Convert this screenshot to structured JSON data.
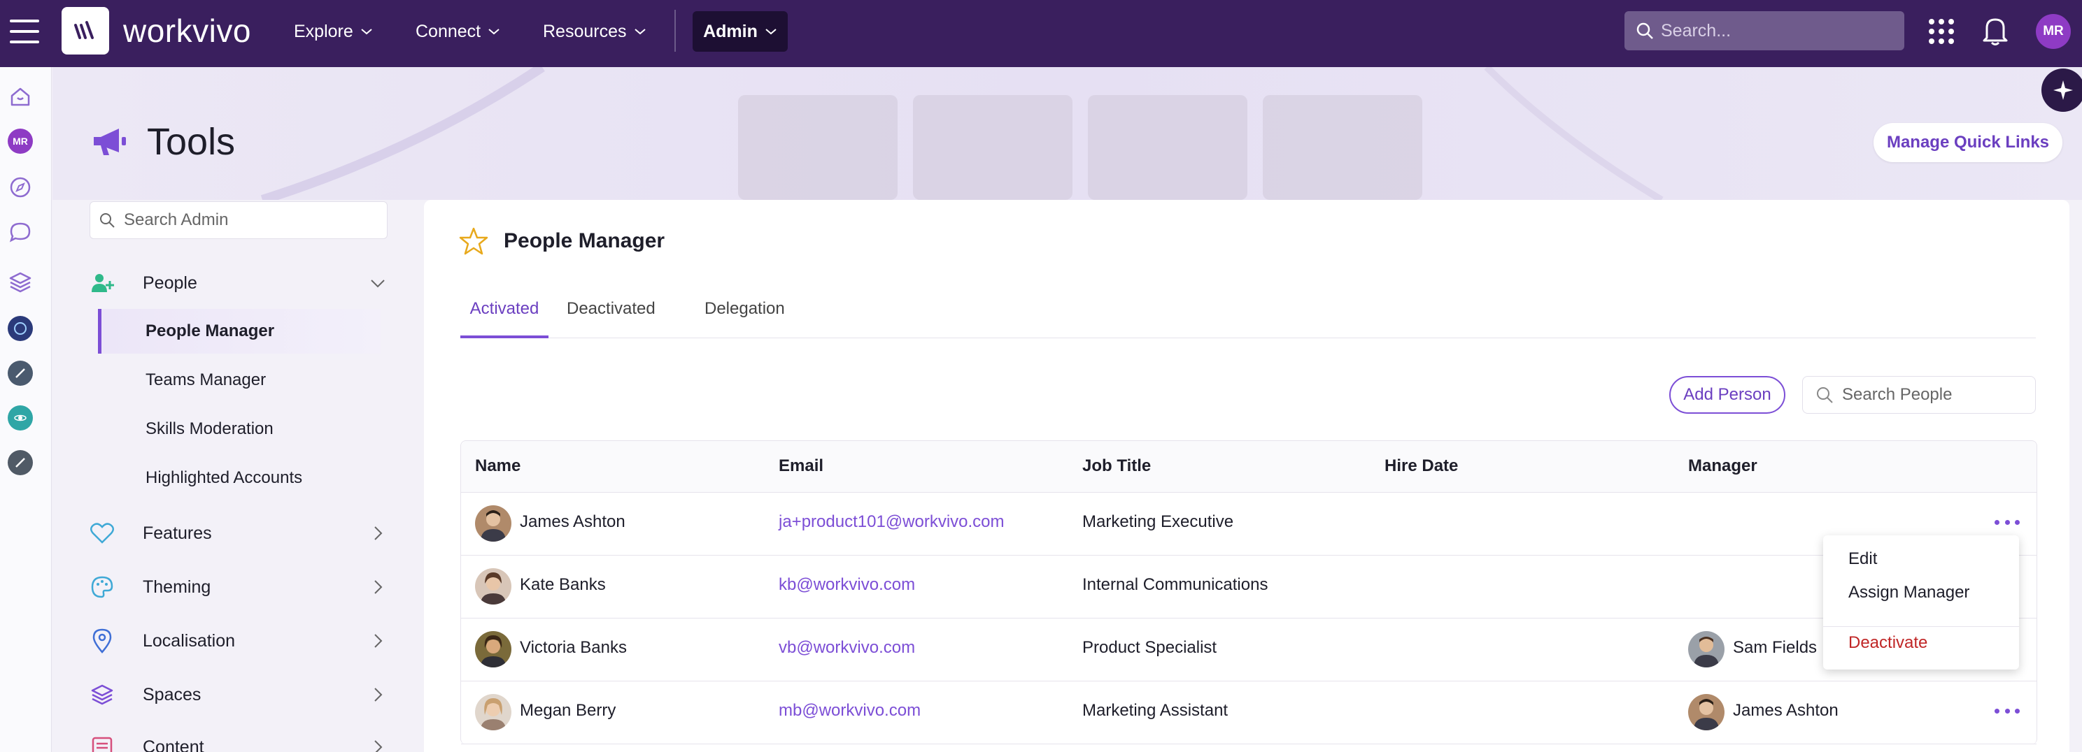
{
  "topbar": {
    "brand": "workvivo",
    "nav": [
      "Explore",
      "Connect",
      "Resources"
    ],
    "admin_label": "Admin",
    "search_placeholder": "Search...",
    "user_initials": "MR"
  },
  "rail": {
    "user_initials": "MR"
  },
  "page": {
    "title": "Tools",
    "quick_links_label": "Manage Quick Links"
  },
  "sidebar": {
    "search_placeholder": "Search Admin",
    "people_label": "People",
    "people_items": [
      "People Manager",
      "Teams Manager",
      "Skills Moderation",
      "Highlighted Accounts"
    ],
    "sections": [
      "Features",
      "Theming",
      "Localisation",
      "Spaces",
      "Content"
    ]
  },
  "card": {
    "title": "People Manager",
    "tabs": [
      "Activated",
      "Deactivated",
      "Delegation"
    ],
    "active_tab": "Activated",
    "add_person_label": "Add Person",
    "search_people_placeholder": "Search People",
    "columns": [
      "Name",
      "Email",
      "Job Title",
      "Hire Date",
      "Manager"
    ],
    "rows": [
      {
        "name": "James Ashton",
        "email": "ja+product101@workvivo.com",
        "job_title": "Marketing Executive",
        "hire_date": "",
        "manager": ""
      },
      {
        "name": "Kate Banks",
        "email": "kb@workvivo.com",
        "job_title": "Internal Communications",
        "hire_date": "",
        "manager": ""
      },
      {
        "name": "Victoria Banks",
        "email": "vb@workvivo.com",
        "job_title": "Product Specialist",
        "hire_date": "",
        "manager": "Sam Fields"
      },
      {
        "name": "Megan Berry",
        "email": "mb@workvivo.com",
        "job_title": "Marketing Assistant",
        "hire_date": "",
        "manager": "James Ashton"
      }
    ]
  },
  "row_menu": {
    "edit_label": "Edit",
    "assign_manager_label": "Assign Manager",
    "deactivate_label": "Deactivate"
  },
  "colors": {
    "topbar_bg": "#3a1f5e",
    "accent": "#7c4ed6",
    "danger": "#c02626"
  }
}
